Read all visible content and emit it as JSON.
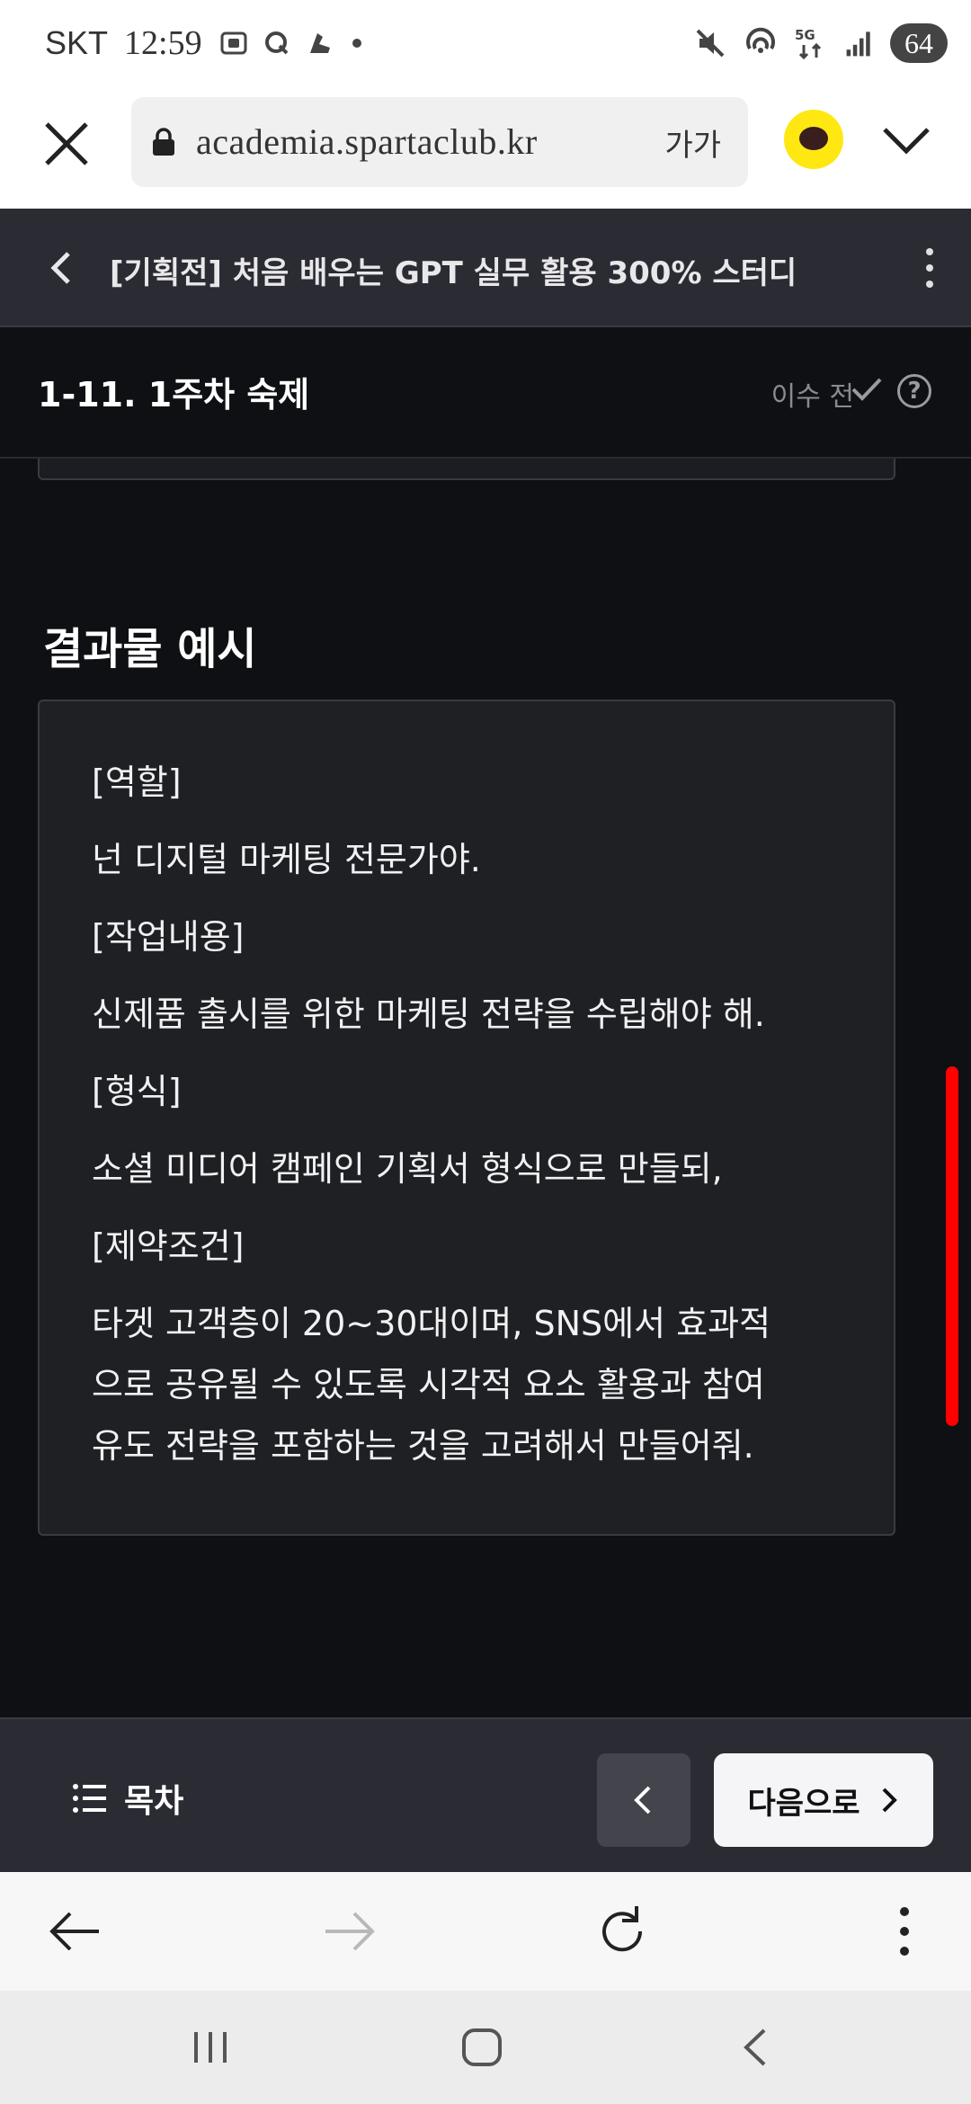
{
  "status_bar": {
    "carrier": "SKT",
    "time": "12:59",
    "network": "5G",
    "battery": "64"
  },
  "browser": {
    "url": "academia.spartaclub.kr",
    "text_size_label": "가가"
  },
  "course_header": {
    "title": "[기획전] 처음 배우는 GPT 실무 활용 300% 스터디"
  },
  "lesson_header": {
    "title": "1-11. 1주차 숙제",
    "status": "이수 전"
  },
  "content": {
    "section_title": "결과물 예시",
    "example_lines": [
      "[역할]",
      "넌 디지털 마케팅 전문가야.",
      "[작업내용]",
      "신제품 출시를 위한 마케팅 전략을 수립해야 해.",
      "[형식]",
      "소셜 미디어 캠페인 기획서 형식으로 만들되,",
      "[제약조건]",
      "타겟 고객층이 20~30대이며, SNS에서 효과적",
      "으로 공유될 수 있도록 시각적 요소 활용과 참여",
      "유도 전략을 포함하는 것을 고려해서 만들어줘."
    ]
  },
  "lesson_nav": {
    "toc_label": "목차",
    "next_label": "다음으로"
  },
  "icons": {
    "close": "close-icon",
    "lock": "lock-icon",
    "kakao": "kakao-chat-icon",
    "chevron_down": "chevron-down-icon",
    "back": "chevron-left-icon",
    "more": "more-vertical-icon",
    "check": "check-icon",
    "help": "help-icon",
    "toc": "list-icon",
    "next": "chevron-right-icon"
  },
  "colors": {
    "page_bg": "#0f1013",
    "header_bg": "#2b2c33",
    "box_bg": "#1f2024",
    "scrollbar": "#ff0000",
    "kakao": "#ffe812"
  }
}
